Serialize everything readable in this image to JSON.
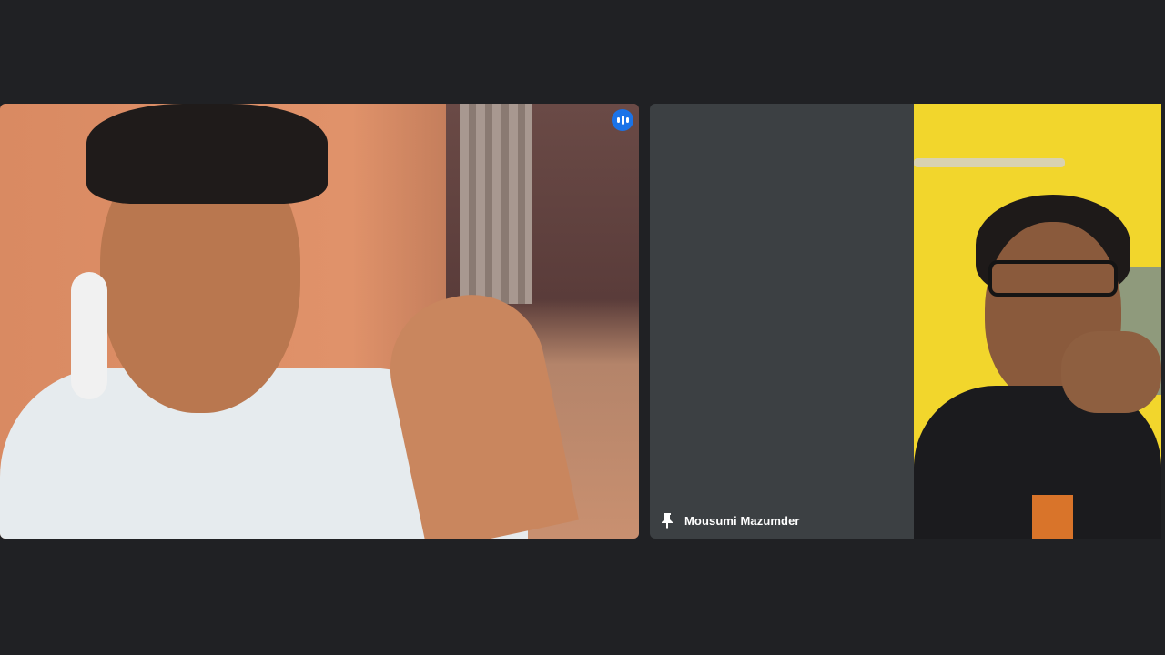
{
  "meeting": {
    "participants": [
      {
        "role": "speaker-video",
        "speaking": true
      },
      {
        "role": "pinned-tile",
        "name": "Mousumi Mazumder",
        "pin_icon": "pin-icon"
      }
    ]
  },
  "colors": {
    "background": "#202124",
    "tile": "#3c4043",
    "speaking_accent": "#1a73e8",
    "text": "#ffffff"
  }
}
